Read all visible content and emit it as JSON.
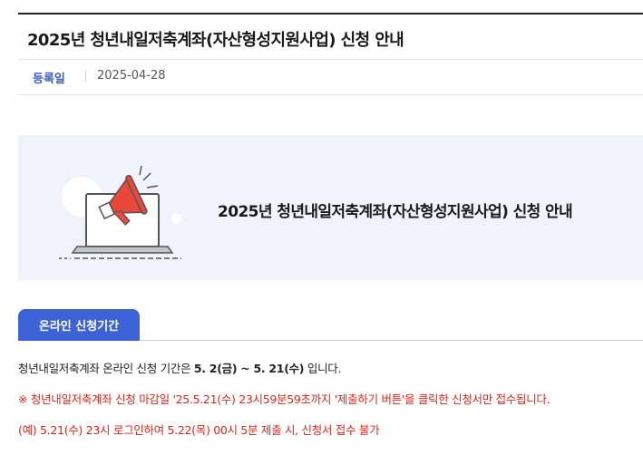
{
  "page": {
    "title": "2025년 청년내일저축계좌(자산형성지원사업) 신청 안내"
  },
  "meta": {
    "date_label": "등록일",
    "date_value": "2025-04-28"
  },
  "banner": {
    "title": "2025년 청년내일저축계좌(자산형성지원사업) 신청 안내",
    "illustration_icon": "laptop-megaphone-icon"
  },
  "tab": {
    "label": "온라인 신청기간"
  },
  "content": {
    "p1_prefix": "청년내일저축계좌 온라인 신청 기간은 ",
    "p1_bold": "5. 2(금) ~ 5. 21(수)",
    "p1_suffix": " 입니다.",
    "p2": "※ 청년내일저축계좌 신청 마감일 '25.5.21(수) 23시59분59초까지 '제출하기 버튼'을 클릭한 신청서만 접수됩니다.",
    "p3": "(예) 5.21(수) 23시 로그인하여 5.22(목) 00시 5분 제출 시, 신청서 접수 불가"
  },
  "colors": {
    "accent": "#3d62d6",
    "label_blue": "#3b5bb8",
    "warning_red": "#d9261c",
    "banner_bg": "#f0f3fb",
    "megaphone_red": "#e8473a"
  }
}
